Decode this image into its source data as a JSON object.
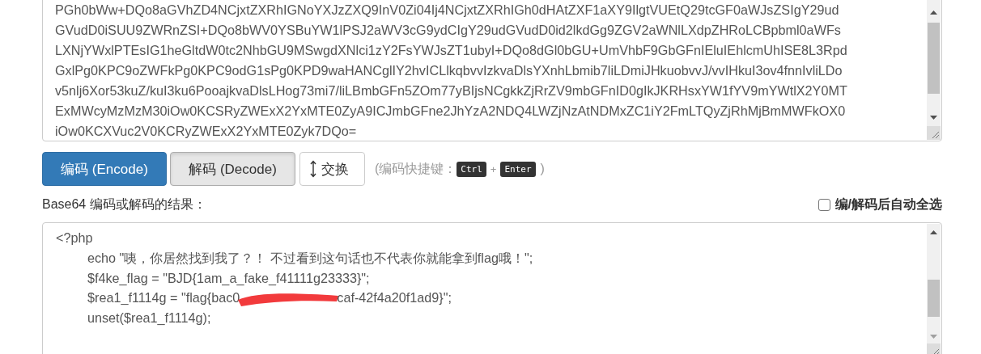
{
  "input_area": {
    "lines": [
      "PGh0bWw+DQo8aGVhZD4NCjxtZXRhIGNoYXJzZXQ9InV0Zi04Ij4NCjxtZXRhIGh0dHAtZXF1aXY9IlgtVUEtQ29tcGF0aWJsZSIgY29ud",
      "GVudD0iSUU9ZWRnZSI+DQo8bWV0YSBuYW1lPSJ2aWV3cG9ydCIgY29udGVudD0id2lkdGg9ZGV2aWNlLXdpZHRoLCBpbml0aWFs",
      "LXNjYWxlPTEsIG1heGltdW0tc2NhbGU9MSwgdXNlci1zY2FsYWJsZT1ubyI+DQo8dGl0bGU+UmVhbF9GbGFnIEluIEhlcmUhISE8L3Rpd",
      "GxlPg0KPC9oZWFkPg0KPC9odG1sPg0KPD9waHANCglIY2hvICLlkqbvvIzkvaDlsYXnhLbmib7liLDmiJHkuobvvJ/vvIHkuI3ov4fnnIvliLDo",
      "v5nlj6Xor53kuZ/kuI3ku6PooajkvaDlsLHog73mi7/liLBmbGFn5ZOm77yBIjsNCgkkZjRrZV9mbGFnID0gIkJKRHsxYW1fYV9mYWtlX2Y0MT",
      "ExMWcyMzMzM30iOw0KCSRyZWExX2YxMTE0ZyA9ICJmbGFne2JhYzA2NDQ4LWZjNzAtNDMxZC1iY2FmLTQyZjRhMjBmMWFkOX0",
      "iOw0KCXVuc2V0KCRyZWExX2YxMTE0Zyk7DQo="
    ]
  },
  "buttons": [
    {
      "label": "编码 (Encode)",
      "kind": "primary"
    },
    {
      "label": "解码 (Decode)",
      "kind": "pressed"
    },
    {
      "label": "交换",
      "kind": "swap"
    }
  ],
  "shortcut_hint": {
    "open": "(编码快捷键：",
    "keys": [
      "Ctrl",
      "Enter"
    ],
    "plus": "+",
    "close": ")"
  },
  "result_label": "Base64 编码或解码的结果：",
  "auto_select": {
    "label": "编/解码后自动全选",
    "checked": false
  },
  "output_area": {
    "lines": [
      {
        "segments": [
          "<?php"
        ]
      },
      {
        "segments": [
          "\techo \"咦，你居然找到我了？！ 不过看到这句话也不代表你就能拿到flag哦！\";"
        ]
      },
      {
        "segments": [
          "\t$f4ke_flag = \"BJD{1am_a_fake_f41111g23333}\";"
        ]
      },
      {
        "segments": [
          "\t$rea1_f1114g = \"flag{bac0",
          "caf-42f4a20f1ad9}\";"
        ]
      },
      {
        "segments": [
          "\tunset($rea1_f1114g);"
        ]
      }
    ]
  }
}
